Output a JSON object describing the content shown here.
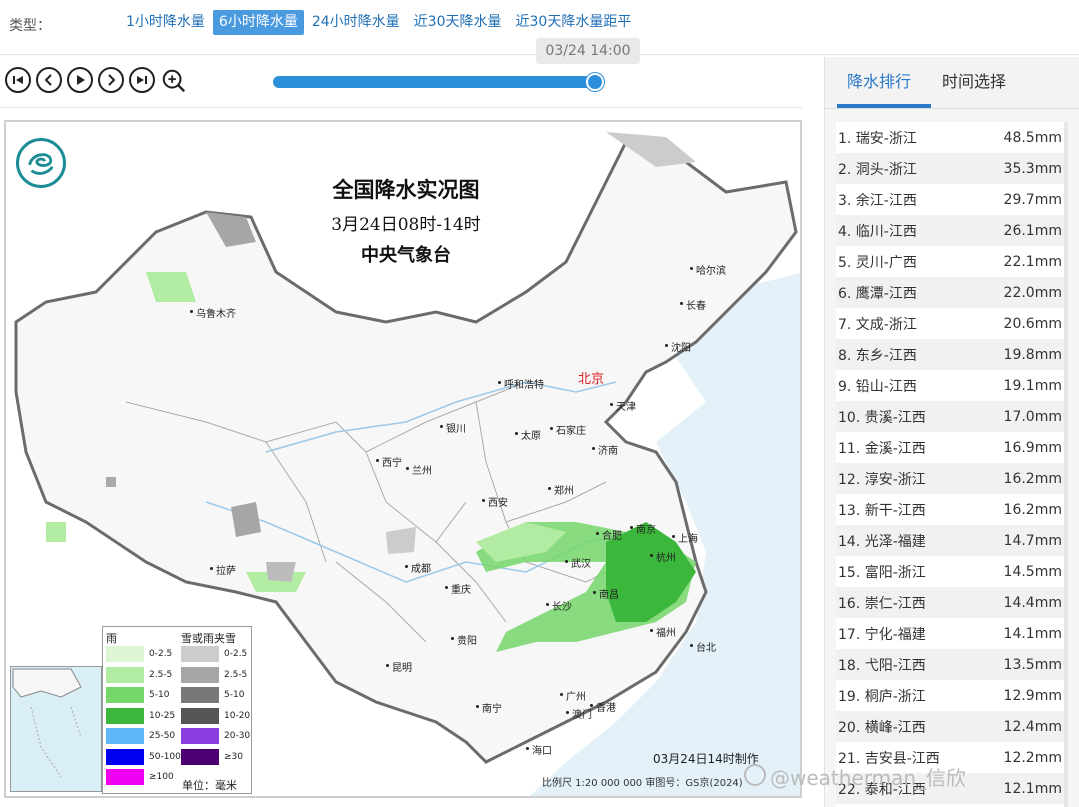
{
  "type_bar": {
    "label": "类型：",
    "tabs": [
      {
        "label": "1小时降水量",
        "active": false
      },
      {
        "label": "6小时降水量",
        "active": true
      },
      {
        "label": "24小时降水量",
        "active": false
      },
      {
        "label": "近30天降水量",
        "active": false
      },
      {
        "label": "近30天降水量距平",
        "active": false
      }
    ]
  },
  "player": {
    "tooltip": "03/24 14:00",
    "progress": 1.0,
    "buttons": [
      "first-icon",
      "prev-icon",
      "play-icon",
      "next-icon",
      "last-icon",
      "zoom-in-icon"
    ]
  },
  "map": {
    "title": "全国降水实况图",
    "subtitle": "3月24日08时-14时",
    "agency": "中央气象台",
    "capital": "北京",
    "made_at": "03月24日14时制作",
    "scale": "比例尺 1:20 000 000  审图号：GS京(2024)",
    "cities": [
      "哈尔滨",
      "长春",
      "沈阳",
      "乌鲁木齐",
      "呼和浩特",
      "天津",
      "银川",
      "太原",
      "石家庄",
      "济南",
      "西宁",
      "兰州",
      "西安",
      "郑州",
      "合肥",
      "南京",
      "上海",
      "杭州",
      "武汉",
      "成都",
      "重庆",
      "拉萨",
      "长沙",
      "南昌",
      "福州",
      "台北",
      "贵阳",
      "昆明",
      "南宁",
      "广州",
      "香港",
      "澳门",
      "海口"
    ],
    "legend": {
      "rain_title": "雨",
      "snow_title": "雪或雨夹雪",
      "rain": [
        {
          "label": "0-2.5",
          "color": "#dcf5d3"
        },
        {
          "label": "2.5-5",
          "color": "#b2eca2"
        },
        {
          "label": "5-10",
          "color": "#75d66a"
        },
        {
          "label": "10-25",
          "color": "#3bb83b"
        },
        {
          "label": "25-50",
          "color": "#60b8f8"
        },
        {
          "label": "50-100",
          "color": "#0000f0"
        },
        {
          "label": "≥100",
          "color": "#f000f0"
        }
      ],
      "snow": [
        {
          "label": "0-2.5",
          "color": "#cccccc"
        },
        {
          "label": "2.5-5",
          "color": "#a6a6a6"
        },
        {
          "label": "5-10",
          "color": "#777777"
        },
        {
          "label": "10-20",
          "color": "#555555"
        },
        {
          "label": "20-30",
          "color": "#8b3ee0"
        },
        {
          "label": "≥30",
          "color": "#4b0072"
        }
      ],
      "unit": "单位：毫米"
    }
  },
  "panel": {
    "tabs": [
      {
        "label": "降水排行",
        "active": true
      },
      {
        "label": "时间选择",
        "active": false
      }
    ],
    "ranking": [
      {
        "name": "1. 瑞安-浙江",
        "value": "48.5mm"
      },
      {
        "name": "2. 洞头-浙江",
        "value": "35.3mm"
      },
      {
        "name": "3. 余江-江西",
        "value": "29.7mm"
      },
      {
        "name": "4. 临川-江西",
        "value": "26.1mm"
      },
      {
        "name": "5. 灵川-广西",
        "value": "22.1mm"
      },
      {
        "name": "6. 鹰潭-江西",
        "value": "22.0mm"
      },
      {
        "name": "7. 文成-浙江",
        "value": "20.6mm"
      },
      {
        "name": "8. 东乡-江西",
        "value": "19.8mm"
      },
      {
        "name": "9. 铅山-江西",
        "value": "19.1mm"
      },
      {
        "name": "10. 贵溪-江西",
        "value": "17.0mm"
      },
      {
        "name": "11. 金溪-江西",
        "value": "16.9mm"
      },
      {
        "name": "12. 淳安-浙江",
        "value": "16.2mm"
      },
      {
        "name": "13. 新干-江西",
        "value": "16.2mm"
      },
      {
        "name": "14. 光泽-福建",
        "value": "14.7mm"
      },
      {
        "name": "15. 富阳-浙江",
        "value": "14.5mm"
      },
      {
        "name": "16. 崇仁-江西",
        "value": "14.4mm"
      },
      {
        "name": "17. 宁化-福建",
        "value": "14.1mm"
      },
      {
        "name": "18. 弋阳-江西",
        "value": "13.5mm"
      },
      {
        "name": "19. 桐庐-浙江",
        "value": "12.9mm"
      },
      {
        "name": "20. 横峰-江西",
        "value": "12.4mm"
      },
      {
        "name": "21. 吉安县-江西",
        "value": "12.2mm"
      },
      {
        "name": "22. 泰和-江西",
        "value": "12.1mm"
      }
    ]
  },
  "watermark": "@weatherman_信欣"
}
